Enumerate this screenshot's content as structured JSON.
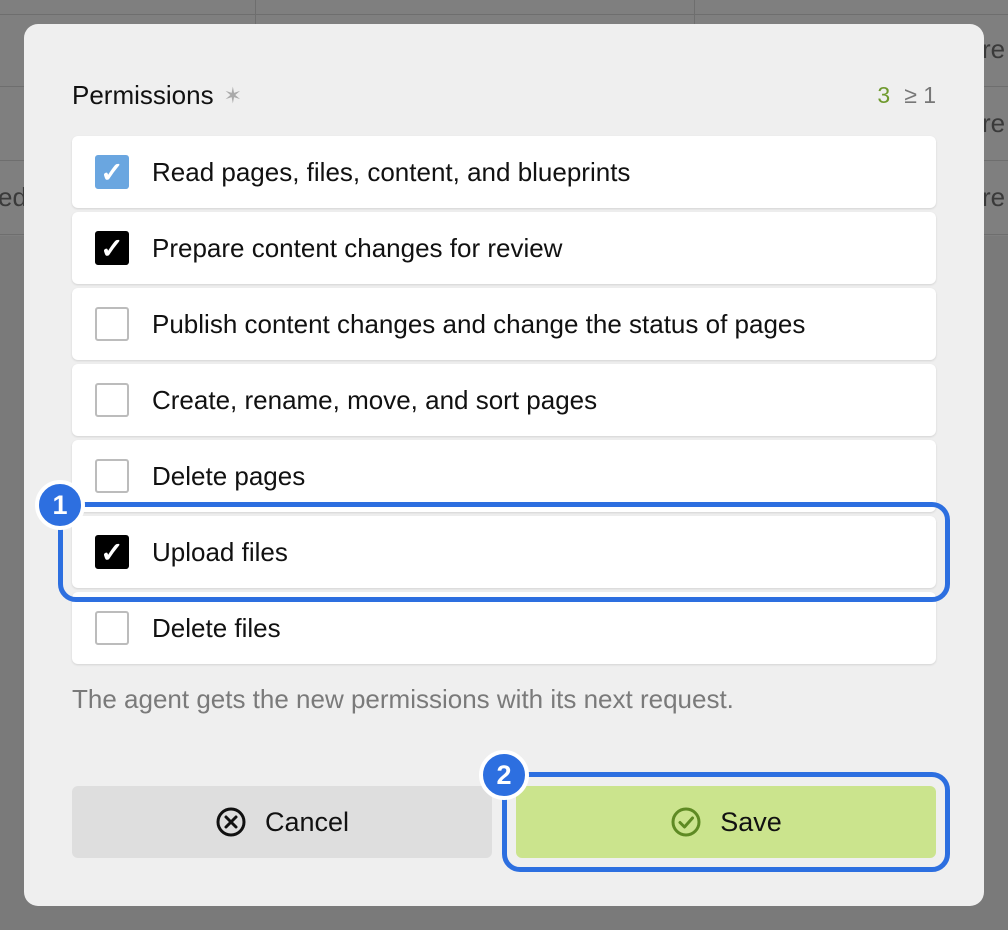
{
  "background": {
    "row_fragments": [
      "re",
      "re",
      "re"
    ],
    "left_fragment": "ed"
  },
  "dialog": {
    "field_label": "Permissions",
    "required_icon": "✶",
    "counter_value": "3",
    "counter_min": "≥ 1",
    "options": [
      {
        "label": "Read pages, files, content, and blueprints",
        "state": "disabled-checked"
      },
      {
        "label": "Prepare content changes for review",
        "state": "checked"
      },
      {
        "label": "Publish content changes and change the status of pages",
        "state": "unchecked"
      },
      {
        "label": "Create, rename, move, and sort pages",
        "state": "unchecked"
      },
      {
        "label": "Delete pages",
        "state": "unchecked"
      },
      {
        "label": "Upload files",
        "state": "checked"
      },
      {
        "label": "Delete files",
        "state": "unchecked"
      }
    ],
    "help": "The agent gets the new permissions with its next request.",
    "cancel_label": "Cancel",
    "save_label": "Save",
    "check_glyph": "✓"
  },
  "annotations": {
    "badge_1": "1",
    "badge_2": "2"
  },
  "colors": {
    "accent_blue": "#2d6fe0",
    "save_green": "#cbe48d",
    "counter_green": "#6f9a2e",
    "disabled_blue": "#6aa6e0"
  }
}
